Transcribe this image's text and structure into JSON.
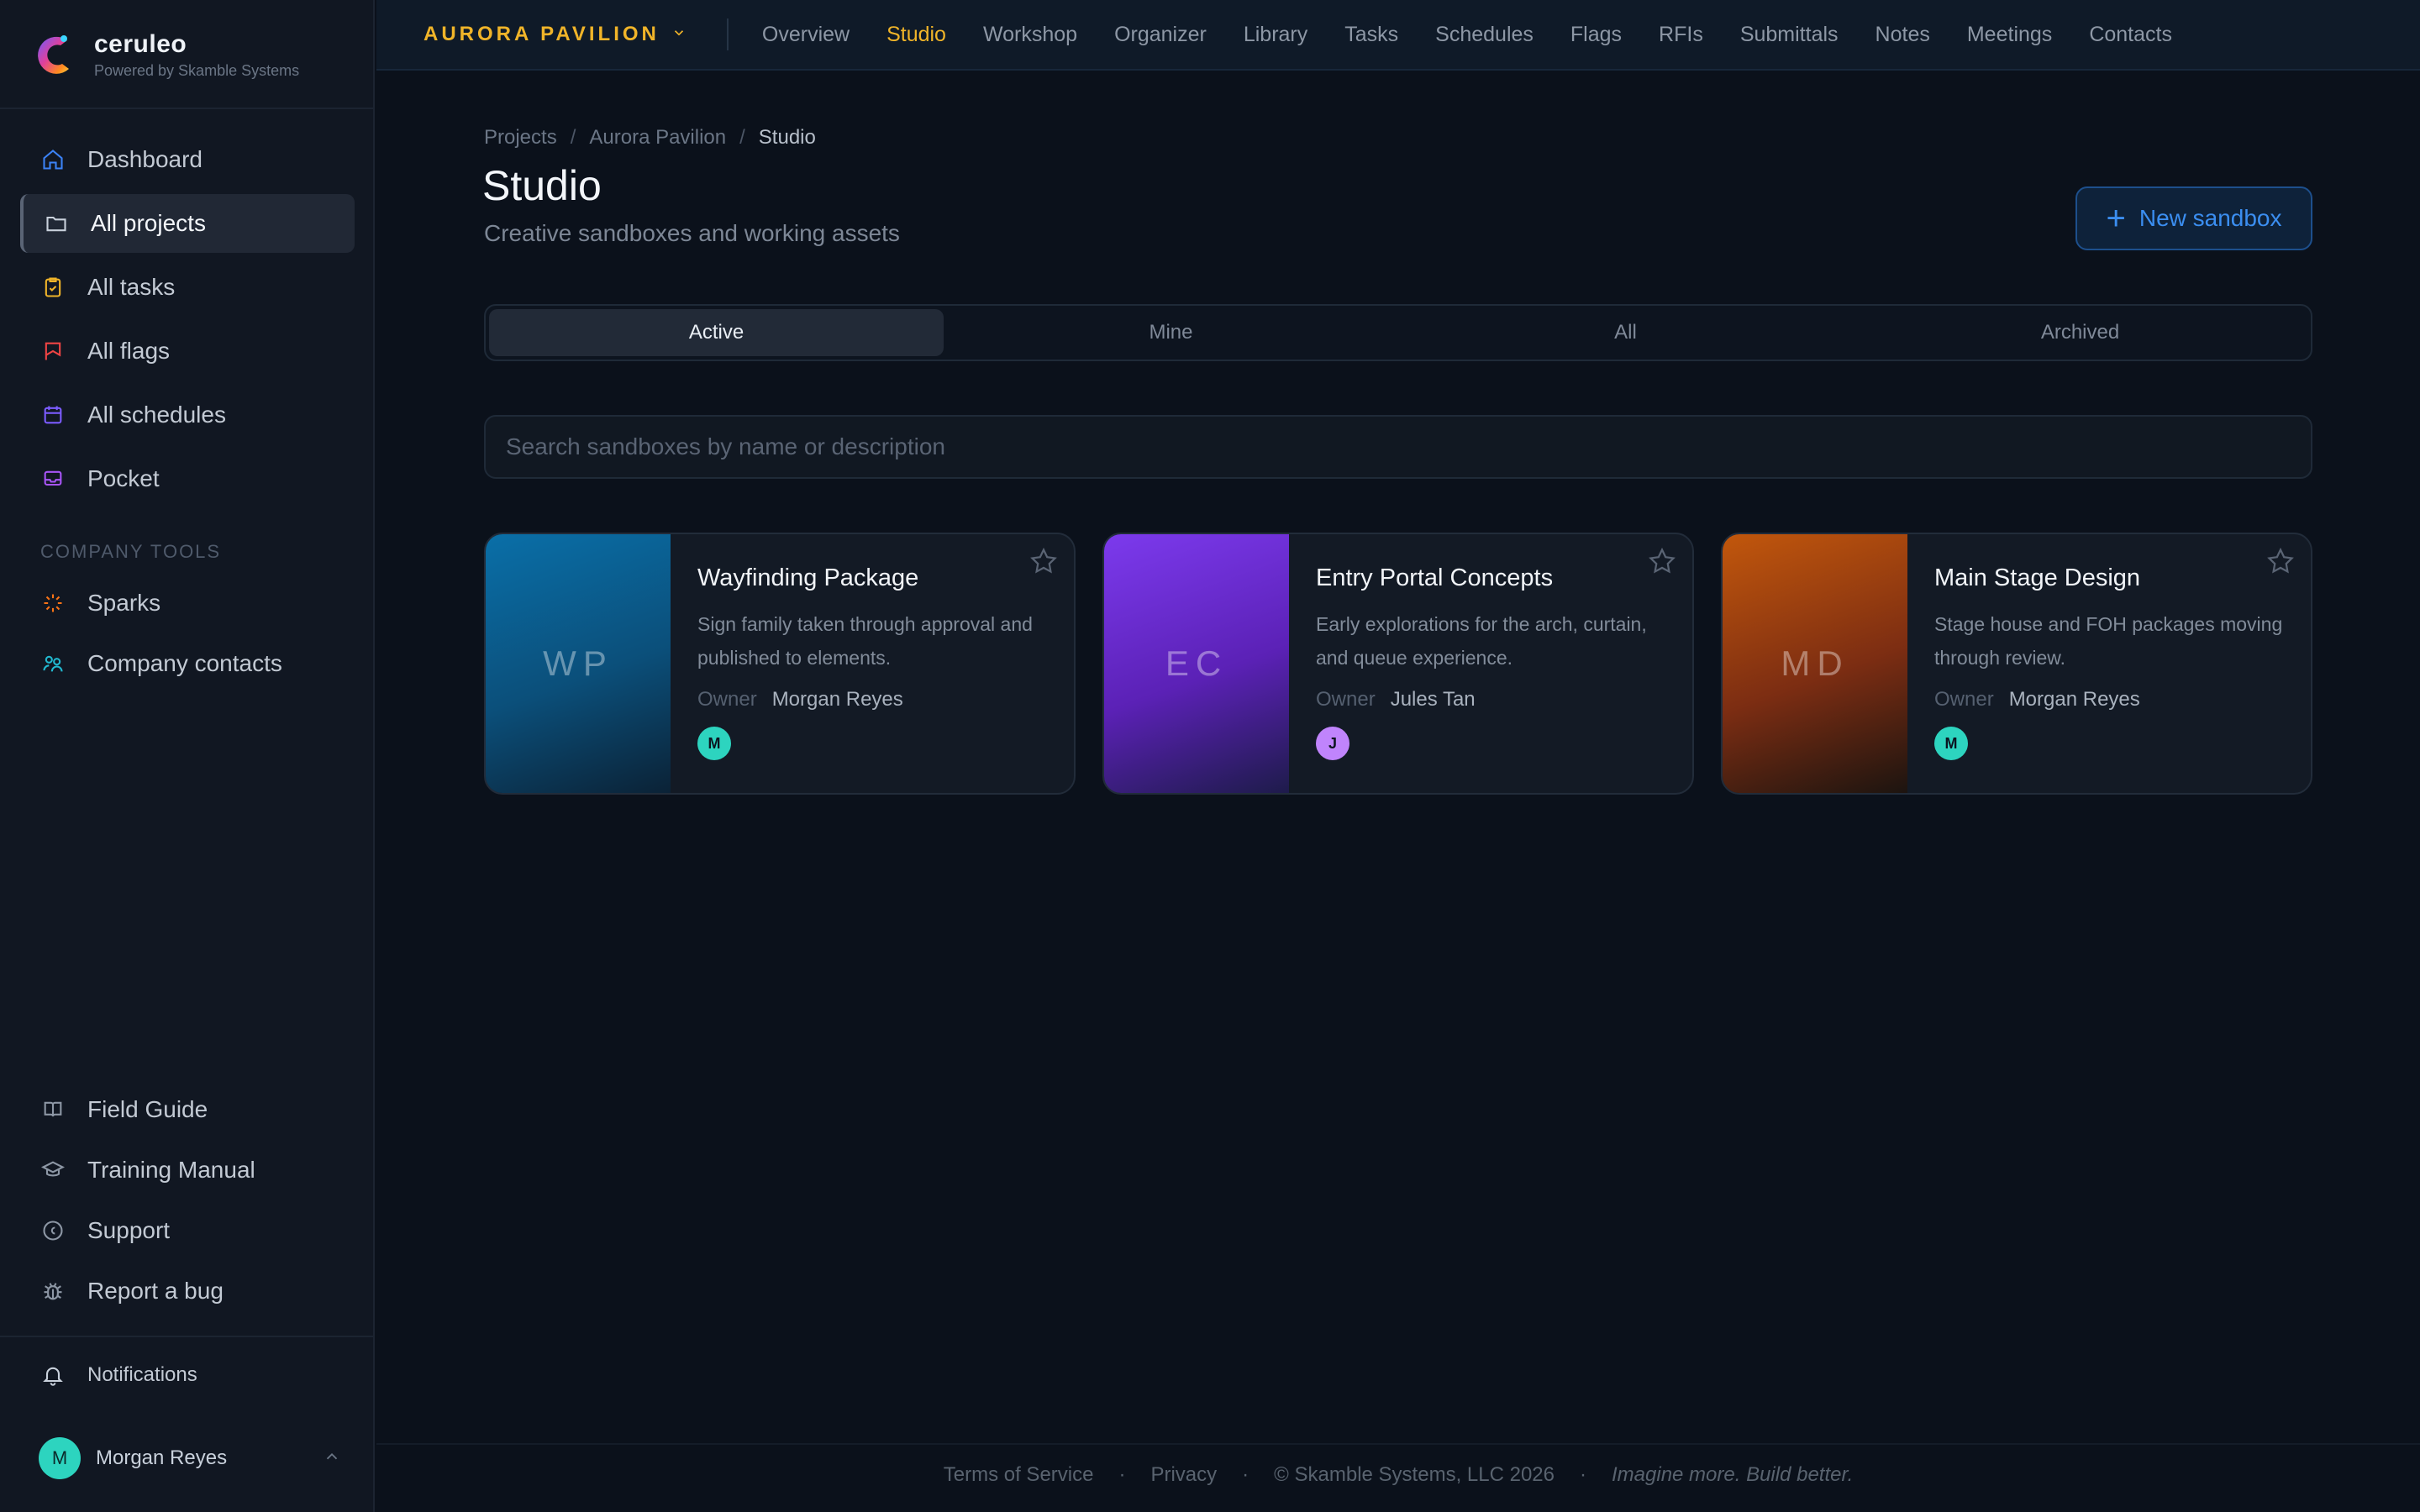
{
  "brand": {
    "name": "ceruleo",
    "subtitle": "Powered by Skamble Systems"
  },
  "sidebar": {
    "items": [
      {
        "label": "Dashboard",
        "icon": "home-icon",
        "color": "#3b82f6"
      },
      {
        "label": "All projects",
        "icon": "folder-icon",
        "color": "#c9d1dc",
        "active": true
      },
      {
        "label": "All tasks",
        "icon": "clipboard-icon",
        "color": "#f0b429"
      },
      {
        "label": "All flags",
        "icon": "flag-icon",
        "color": "#ef4444"
      },
      {
        "label": "All schedules",
        "icon": "calendar-icon",
        "color": "#7c5cff"
      },
      {
        "label": "Pocket",
        "icon": "inbox-icon",
        "color": "#a855f7"
      }
    ],
    "section_label": "COMPANY TOOLS",
    "tools": [
      {
        "label": "Sparks",
        "icon": "sparkle-icon",
        "color": "#f97316"
      },
      {
        "label": "Company contacts",
        "icon": "contacts-icon",
        "color": "#22b8cf"
      }
    ],
    "help": [
      {
        "label": "Field Guide",
        "icon": "book-icon"
      },
      {
        "label": "Training Manual",
        "icon": "graduation-cap-icon"
      },
      {
        "label": "Support",
        "icon": "support-icon"
      },
      {
        "label": "Report a bug",
        "icon": "bug-icon"
      }
    ],
    "notifications": "Notifications",
    "user": {
      "name": "Morgan Reyes",
      "initial": "M"
    }
  },
  "topbar": {
    "project": "AURORA PAVILION",
    "tabs": [
      "Overview",
      "Studio",
      "Workshop",
      "Organizer",
      "Library",
      "Tasks",
      "Schedules",
      "Flags",
      "RFIs",
      "Submittals",
      "Notes",
      "Meetings",
      "Contacts"
    ],
    "active_tab": "Studio"
  },
  "breadcrumb": [
    "Projects",
    "Aurora Pavilion",
    "Studio"
  ],
  "page": {
    "title": "Studio",
    "subtitle": "Creative sandboxes and working assets",
    "new_button": "New sandbox"
  },
  "filters": [
    "Active",
    "Mine",
    "All",
    "Archived"
  ],
  "active_filter": "Active",
  "search": {
    "placeholder": "Search sandboxes by name or description",
    "value": ""
  },
  "owner_label": "Owner",
  "cards": [
    {
      "initials": "WP",
      "title": "Wayfinding Package",
      "description": "Sign family taken through approval and published to elements.",
      "owner": "Morgan Reyes",
      "owner_initial": "M",
      "thumb_color": "#0a6fa8",
      "avatar_color": "#2dd4bf"
    },
    {
      "initials": "EC",
      "title": "Entry Portal Concepts",
      "description": "Early explorations for the arch, curtain, and queue experience.",
      "owner": "Jules Tan",
      "owner_initial": "J",
      "thumb_color": "#7c3aed",
      "avatar_color": "#c084fc"
    },
    {
      "initials": "MD",
      "title": "Main Stage Design",
      "description": "Stage house and FOH packages moving through review.",
      "owner": "Morgan Reyes",
      "owner_initial": "M",
      "thumb_color": "#c2570c",
      "avatar_color": "#2dd4bf"
    }
  ],
  "footer": {
    "terms": "Terms of Service",
    "privacy": "Privacy",
    "copyright": "© Skamble Systems, LLC 2026",
    "tagline": "Imagine more. Build better."
  }
}
